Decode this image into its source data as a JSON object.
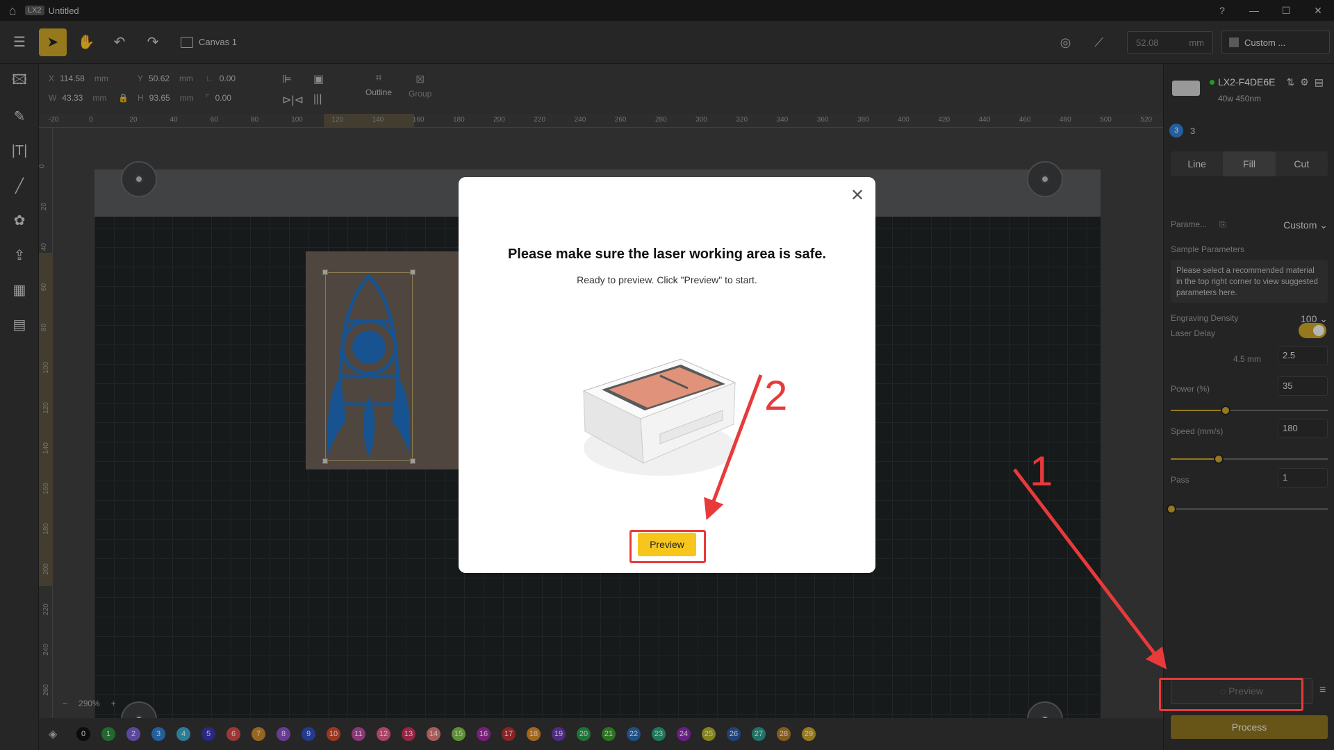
{
  "titlebar": {
    "badge": "LX2",
    "title": "Untitled",
    "home_icon": "home-icon"
  },
  "toolbar": {
    "canvas_tab": "Canvas 1",
    "zoom_value": "52.08",
    "zoom_unit": "mm",
    "custom_label": "Custom ..."
  },
  "props": {
    "x_label": "X",
    "x_value": "114.58",
    "y_label": "Y",
    "y_value": "50.62",
    "w_label": "W",
    "w_value": "43.33",
    "h_label": "H",
    "h_value": "93.65",
    "unit": "mm",
    "angle_value": "0.00",
    "radius_value": "0.00",
    "outline_label": "Outline",
    "group_label": "Group"
  },
  "ruler_h": [
    "-20",
    "0",
    "20",
    "40",
    "60",
    "80",
    "100",
    "120",
    "140",
    "160",
    "180",
    "200",
    "220",
    "240",
    "260",
    "280",
    "300",
    "320",
    "340",
    "360",
    "380",
    "400",
    "420",
    "440",
    "460",
    "480",
    "500",
    "520"
  ],
  "ruler_v": [
    "0",
    "20",
    "40",
    "60",
    "80",
    "100",
    "120",
    "140",
    "160",
    "180",
    "200",
    "220",
    "240",
    "260"
  ],
  "canvas": {
    "zoom_label": "290%"
  },
  "layers": [
    {
      "n": "0",
      "c": "#111111"
    },
    {
      "n": "1",
      "c": "#2e8b3e"
    },
    {
      "n": "2",
      "c": "#7b5fcf"
    },
    {
      "n": "3",
      "c": "#2f7fd2"
    },
    {
      "n": "4",
      "c": "#3aa6c9"
    },
    {
      "n": "5",
      "c": "#3a35b0"
    },
    {
      "n": "6",
      "c": "#d24a4a"
    },
    {
      "n": "7",
      "c": "#c9892c"
    },
    {
      "n": "8",
      "c": "#8a4fc4"
    },
    {
      "n": "9",
      "c": "#2d4fbf"
    },
    {
      "n": "10",
      "c": "#d04a2a"
    },
    {
      "n": "11",
      "c": "#b84aa0"
    },
    {
      "n": "12",
      "c": "#e25a8a"
    },
    {
      "n": "13",
      "c": "#c9305a"
    },
    {
      "n": "14",
      "c": "#e07a7a"
    },
    {
      "n": "15",
      "c": "#7fbf4a"
    },
    {
      "n": "16",
      "c": "#a02aa0"
    },
    {
      "n": "17",
      "c": "#b83030"
    },
    {
      "n": "18",
      "c": "#d9882a"
    },
    {
      "n": "19",
      "c": "#6a3ab0"
    },
    {
      "n": "20",
      "c": "#2a9a4a"
    },
    {
      "n": "21",
      "c": "#3a9a2a"
    },
    {
      "n": "22",
      "c": "#2a6ab0"
    },
    {
      "n": "23",
      "c": "#2aa07a"
    },
    {
      "n": "24",
      "c": "#8a2ab0"
    },
    {
      "n": "25",
      "c": "#b0b02a"
    },
    {
      "n": "26",
      "c": "#2a5aa0"
    },
    {
      "n": "27",
      "c": "#2a9a8a"
    },
    {
      "n": "28",
      "c": "#b07a2a"
    },
    {
      "n": "29",
      "c": "#c9a227"
    }
  ],
  "right": {
    "device_name": "LX2-F4DE6E",
    "device_sub": "40w 450nm",
    "layer_num": "3",
    "layer_label": "3",
    "tabs": [
      "Line",
      "Fill",
      "Cut"
    ],
    "param_label": "Parame...",
    "param_value": "Custom",
    "sample_label": "Sample Parameters",
    "hint": "Please select a recommended material in the top right corner to view suggested parameters here.",
    "density_label": "Engraving Density",
    "density_value": "100",
    "delay_label": "Laser Delay",
    "delay_sub": "4.5 mm",
    "delay_value": "2.5",
    "power_label": "Power  (%)",
    "power_value": "35",
    "speed_label": "Speed  (mm/s)",
    "speed_value": "180",
    "pass_label": "Pass",
    "pass_value": "1",
    "preview_label": "Preview",
    "process_label": "Process"
  },
  "modal": {
    "title": "Please make sure the laser working area is safe.",
    "desc": "Ready to preview. Click \"Preview\" to start.",
    "preview_label": "Preview"
  },
  "annotations": {
    "one": "1",
    "two": "2"
  }
}
